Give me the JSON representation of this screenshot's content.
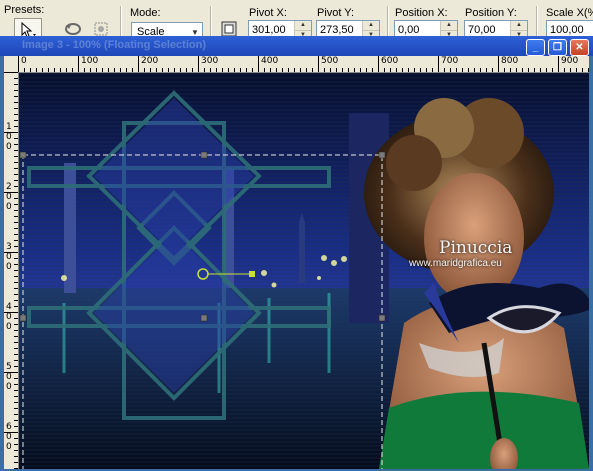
{
  "toolbar": {
    "presets_label": "Presets:",
    "mode_label": "Mode:",
    "mode_value": "Scale",
    "pivot_x_label": "Pivot X:",
    "pivot_x_value": "301,00",
    "pivot_y_label": "Pivot Y:",
    "pivot_y_value": "273,50",
    "position_x_label": "Position X:",
    "position_x_value": "0,00",
    "position_y_label": "Position Y:",
    "position_y_value": "70,00",
    "scale_x_label": "Scale X(%)",
    "scale_x_value": "100,00",
    "icons": [
      "pointer-tool-icon",
      "rotate-icon",
      "reset-icon",
      "perspective-grid-icon"
    ]
  },
  "window": {
    "title": "Image 3 - 100% (Floating Selection)",
    "minimize": "_",
    "restore": "❐",
    "close": "✕"
  },
  "ruler": {
    "h_labels": [
      "0",
      "100",
      "200",
      "300",
      "400",
      "500",
      "600",
      "700",
      "800",
      "900"
    ],
    "v_labels": [
      "1 0 0",
      "2 0 0",
      "3 0 0",
      "4 0 0",
      "5 0 0",
      "6 0 0"
    ]
  },
  "watermark": {
    "name": "Pinuccia",
    "url": "www.maridgrafica.eu"
  },
  "colors": {
    "accent": "#316ac5",
    "canvas_bg": "#0b1748",
    "frame": "#2e6e78"
  }
}
